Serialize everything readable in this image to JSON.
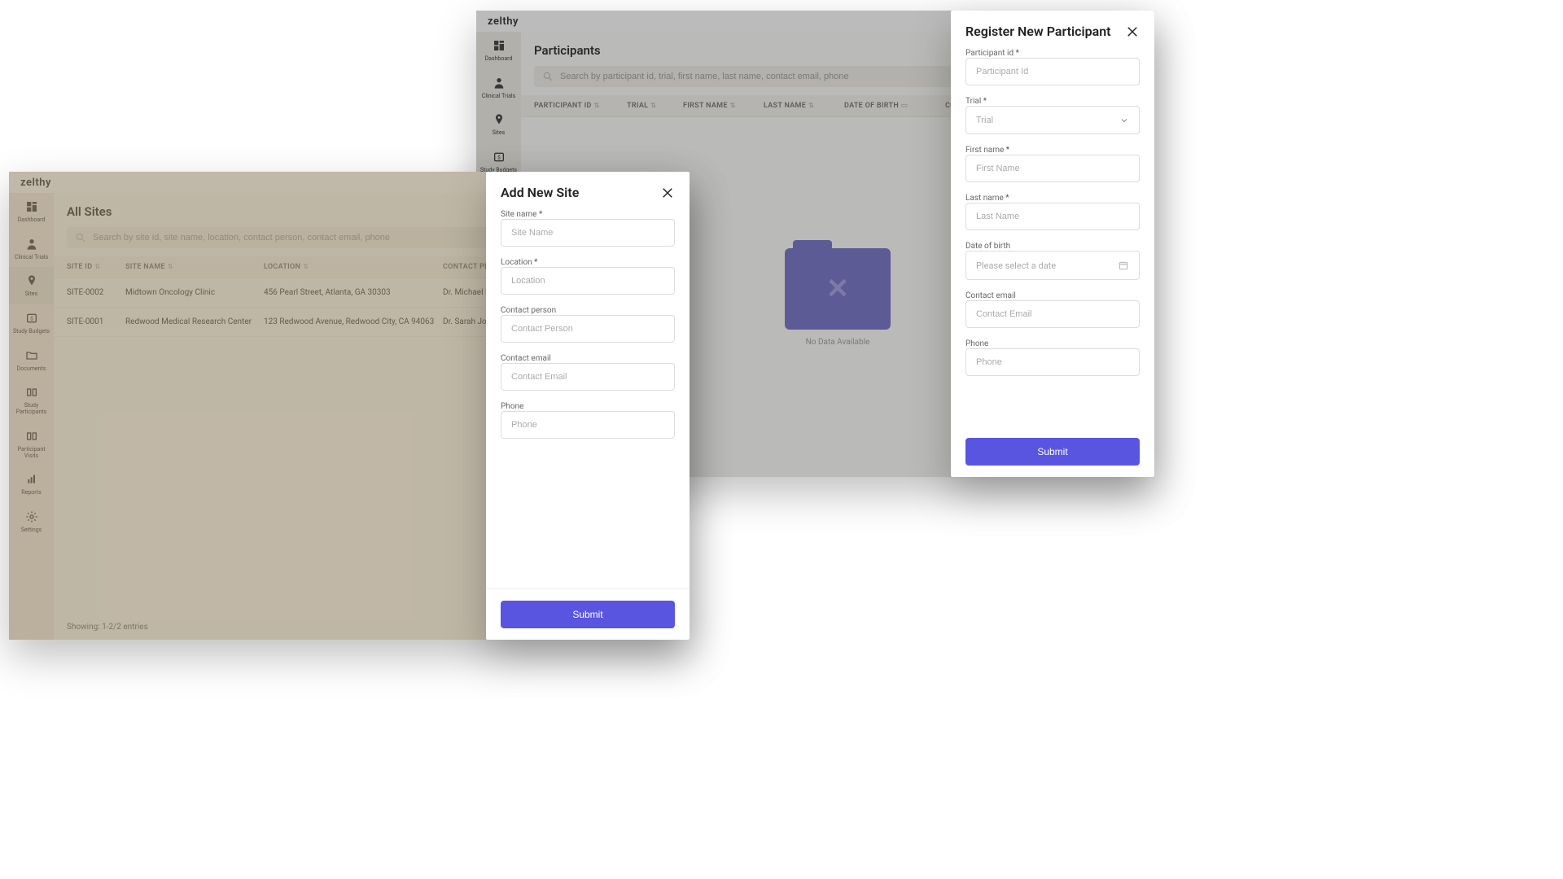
{
  "brand": "zelthy",
  "sidebar_common": {
    "dashboard": "Dashboard",
    "clinical_trials": "Clinical Trials",
    "sites": "Sites",
    "study_budgets": "Study Budgets",
    "documents": "Documents",
    "study_participants": "Study Participants",
    "participant_visits": "Participant Visits",
    "reports": "Reports",
    "settings": "Settings"
  },
  "windowA": {
    "page_title": "All Sites",
    "search_placeholder": "Search by site id, site name, location, contact person, contact email, phone",
    "columns": {
      "site_id": "SITE ID",
      "site_name": "SITE NAME",
      "location": "LOCATION",
      "contact_person": "CONTACT PERSON"
    },
    "rows": [
      {
        "site_id": "SITE-0002",
        "site_name": "Midtown Oncology Clinic",
        "location": "456 Pearl Street, Atlanta, GA 30303",
        "contact_person": "Dr. Michael Be"
      },
      {
        "site_id": "SITE-0001",
        "site_name": "Redwood Medical Research Center",
        "location": "123 Redwood Avenue, Redwood City, CA 94063",
        "contact_person": "Dr. Sarah John"
      }
    ],
    "pager": "Showing: 1-2/2 entries",
    "drawer": {
      "title": "Add New Site",
      "site_name_label": "Site name",
      "site_name_ph": "Site Name",
      "location_label": "Location",
      "location_ph": "Location",
      "contact_person_label": "Contact person",
      "contact_person_ph": "Contact Person",
      "contact_email_label": "Contact email",
      "contact_email_ph": "Contact Email",
      "phone_label": "Phone",
      "phone_ph": "Phone",
      "submit": "Submit"
    }
  },
  "windowB": {
    "page_title": "Participants",
    "search_placeholder": "Search by participant id, trial, first name, last name, contact email, phone",
    "columns": {
      "participant_id": "PARTICIPANT ID",
      "trial": "TRIAL",
      "first_name": "FIRST NAME",
      "last_name": "LAST NAME",
      "dob": "DATE OF BIRTH",
      "contact_email": "CONTACT EMAIL"
    },
    "nodata": "No Data Available",
    "drawer": {
      "title": "Register New Participant",
      "participant_id_label": "Participant id",
      "participant_id_ph": "Participant Id",
      "trial_label": "Trial",
      "trial_ph": "Trial",
      "first_name_label": "First name",
      "first_name_ph": "First Name",
      "last_name_label": "Last name",
      "last_name_ph": "Last Name",
      "dob_label": "Date of birth",
      "dob_ph": "Please select a date",
      "contact_email_label": "Contact email",
      "contact_email_ph": "Contact Email",
      "phone_label": "Phone",
      "phone_ph": "Phone",
      "submit": "Submit"
    }
  }
}
